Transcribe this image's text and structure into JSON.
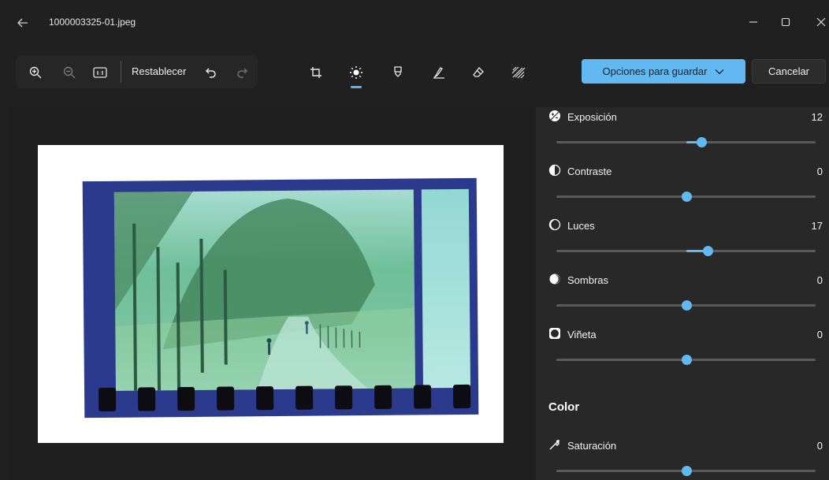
{
  "window": {
    "filename": "1000003325-01.jpeg"
  },
  "toolbar": {
    "reset_label": "Restablecer",
    "save_label": "Opciones para guardar",
    "cancel_label": "Cancelar"
  },
  "adjustments": [
    {
      "label": "Exposición",
      "value": "12",
      "level": 0.56,
      "icon": "exposure-icon"
    },
    {
      "label": "Contraste",
      "value": "0",
      "level": 0.5,
      "icon": "contrast-icon"
    },
    {
      "label": "Luces",
      "value": "17",
      "level": 0.585,
      "icon": "highlights-icon"
    },
    {
      "label": "Sombras",
      "value": "0",
      "level": 0.5,
      "icon": "shadows-icon"
    },
    {
      "label": "Viñeta",
      "value": "0",
      "level": 0.5,
      "icon": "vignette-icon"
    }
  ],
  "color_section": {
    "title": "Color",
    "saturation": {
      "label": "Saturación",
      "value": "0",
      "level": 0.5,
      "icon": "saturation-icon"
    }
  },
  "colors": {
    "accent": "#62b9f1",
    "background": "#202020",
    "panel": "#282828"
  }
}
